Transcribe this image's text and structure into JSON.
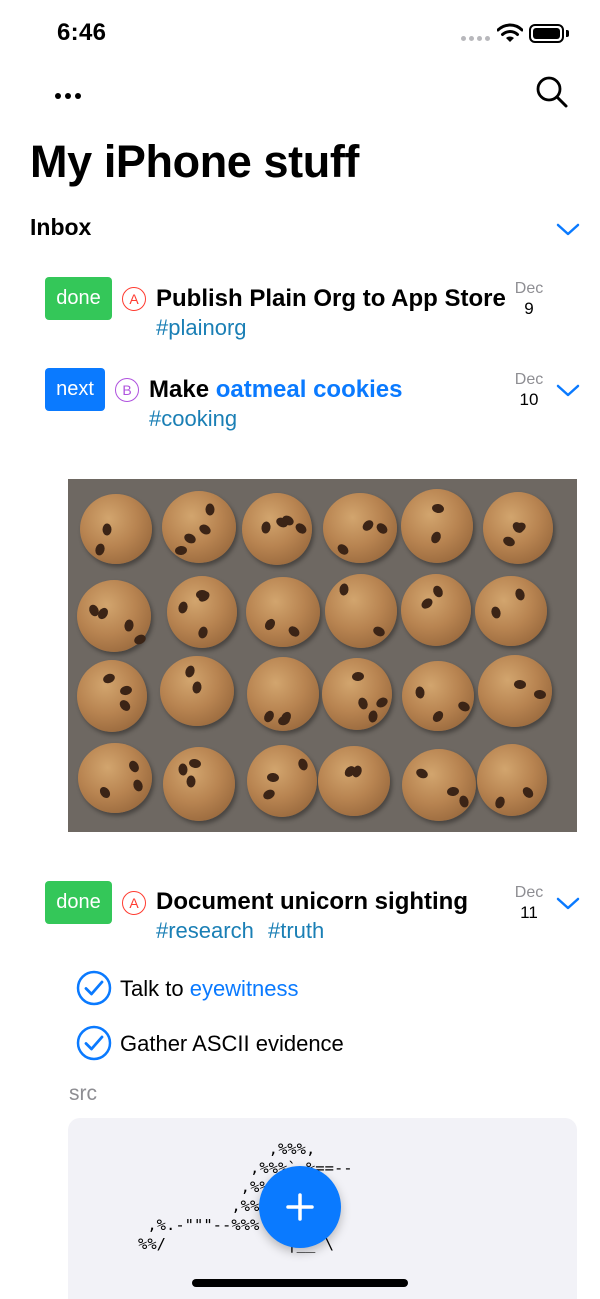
{
  "status_bar": {
    "time": "6:46"
  },
  "header": {
    "title": "My iPhone stuff"
  },
  "section": {
    "label": "Inbox"
  },
  "tasks": [
    {
      "state": "done",
      "priority": "A",
      "title": "Publish Plain Org to App Store",
      "tags": [
        "#plainorg"
      ],
      "date": {
        "month": "Dec",
        "day": "9"
      }
    },
    {
      "state": "next",
      "priority": "B",
      "title_prefix": "Make ",
      "title_link": "oatmeal cookies",
      "tags": [
        "#cooking"
      ],
      "date": {
        "month": "Dec",
        "day": "10"
      }
    },
    {
      "state": "done",
      "priority": "A",
      "title": "Document unicorn sighting",
      "tags": [
        "#research",
        "#truth"
      ],
      "date": {
        "month": "Dec",
        "day": "11"
      }
    }
  ],
  "checklist": [
    {
      "prefix": "Talk to ",
      "link": "eyewitness"
    },
    {
      "text": "Gather ASCII evidence"
    }
  ],
  "src": {
    "label": "src",
    "code": "              ,%%%,\n            ,%%%` %==--\n           ,%%`( '|\n          ,%%@ /\\_/\n ,%.-\"\"\"--%%% \"@@__\n%%/             |__`\\"
  },
  "icons": {
    "more": "ellipsis-icon",
    "search": "search-icon",
    "chevron": "chevron-down-icon",
    "check": "checkmark-circle-icon",
    "add": "plus-icon"
  },
  "colors": {
    "accent": "#0a7aff",
    "done": "#34c759",
    "priority_a": "#ff3b30",
    "priority_b": "#af52de",
    "tag": "#1a7fb5"
  }
}
